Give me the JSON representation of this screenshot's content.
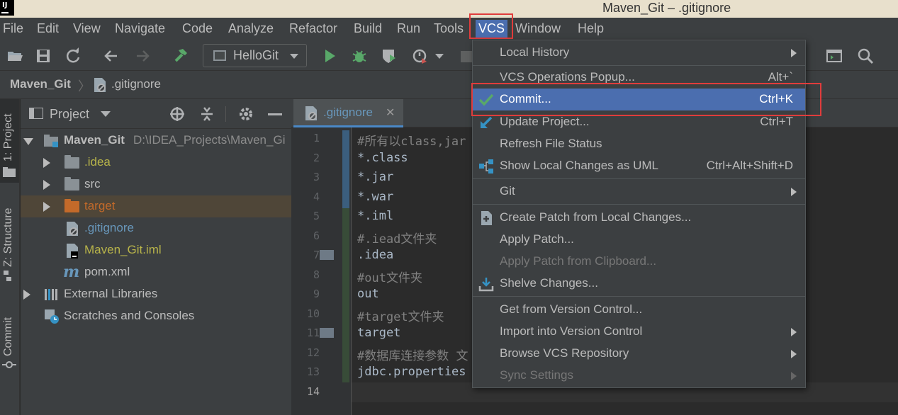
{
  "window": {
    "title": "Maven_Git – .gitignore"
  },
  "menubar": {
    "items": [
      "File",
      "Edit",
      "View",
      "Navigate",
      "Code",
      "Analyze",
      "Refactor",
      "Build",
      "Run",
      "Tools",
      "VCS",
      "Window",
      "Help"
    ],
    "active": "VCS"
  },
  "toolbar": {
    "run_config": "HelloGit"
  },
  "navbar": {
    "project": "Maven_Git",
    "file": ".gitignore"
  },
  "left_stripe": {
    "project": "1: Project",
    "structure": "Z: Structure",
    "commit": "Commit"
  },
  "project_panel": {
    "title": "Project",
    "root": {
      "name": "Maven_Git",
      "path": "D:\\IDEA_Projects\\Maven_Gi"
    },
    "items": [
      {
        "label": ".idea",
        "color": "#b8b44a"
      },
      {
        "label": "src",
        "color": "#bbbbbb"
      },
      {
        "label": "target",
        "color": "#c36a2a"
      },
      {
        "label": ".gitignore",
        "color": "#6897bb"
      },
      {
        "label": "Maven_Git.iml",
        "color": "#b8b44a"
      },
      {
        "label": "pom.xml",
        "color": "#bbbbbb"
      }
    ],
    "external_libraries": "External Libraries",
    "scratches": "Scratches and Consoles"
  },
  "editor": {
    "tab": ".gitignore",
    "line_numbers": [
      "1",
      "2",
      "3",
      "4",
      "5",
      "6",
      "7",
      "8",
      "9",
      "10",
      "11",
      "12",
      "13",
      "14"
    ],
    "lines": [
      "#所有以class,jar",
      "*.class",
      "*.jar",
      "*.war",
      "*.iml",
      "#.iead文件夹",
      ".idea",
      "#out文件夹",
      "out",
      "#target文件夹",
      "target",
      "#数据库连接参数 文",
      "jdbc.properties",
      ""
    ]
  },
  "vcs_menu": {
    "local_history": "Local History",
    "vcs_operations": "VCS Operations Popup...",
    "vcs_operations_shortcut": "Alt+`",
    "commit": "Commit...",
    "commit_shortcut": "Ctrl+K",
    "update_project": "Update Project...",
    "update_project_shortcut": "Ctrl+T",
    "refresh_file_status": "Refresh File Status",
    "show_local_changes_uml": "Show Local Changes as UML",
    "show_local_changes_uml_shortcut": "Ctrl+Alt+Shift+D",
    "git": "Git",
    "create_patch": "Create Patch from Local Changes...",
    "apply_patch": "Apply Patch...",
    "apply_patch_clipboard": "Apply Patch from Clipboard...",
    "shelve_changes": "Shelve Changes...",
    "get_from_vc": "Get from Version Control...",
    "import_into_vc": "Import into Version Control",
    "browse_vcs_repo": "Browse VCS Repository",
    "sync_settings": "Sync Settings"
  }
}
